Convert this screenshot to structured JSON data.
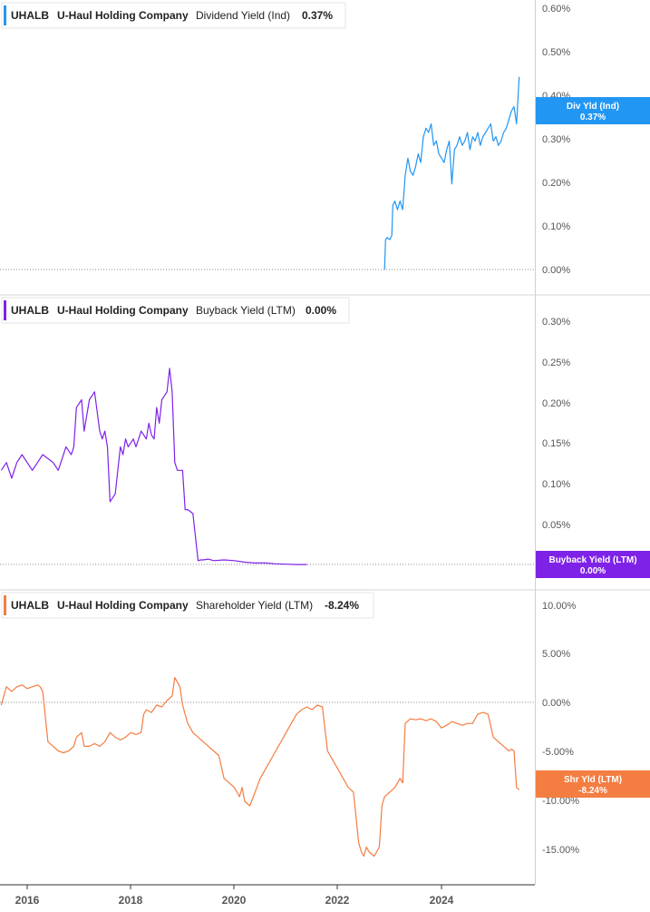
{
  "ticker": "UHALB",
  "company": "U-Haul Holding Company",
  "x_ticks": [
    "2016",
    "2018",
    "2020",
    "2022",
    "2024"
  ],
  "colors": {
    "dividend": "#2196f3",
    "buyback": "#7f22e8",
    "shareholder": "#f47d42"
  },
  "chart_data": [
    {
      "type": "line",
      "series": [
        {
          "name": "Dividend Yield (Ind)",
          "x": [
            2022.9,
            2022.92,
            2022.95,
            2023.0,
            2023.04,
            2023.06,
            2023.1,
            2023.15,
            2023.2,
            2023.25,
            2023.3,
            2023.35,
            2023.4,
            2023.45,
            2023.5,
            2023.55,
            2023.6,
            2023.65,
            2023.7,
            2023.75,
            2023.8,
            2023.85,
            2023.9,
            2023.95,
            2024.0,
            2024.05,
            2024.1,
            2024.15,
            2024.2,
            2024.25,
            2024.3,
            2024.35,
            2024.4,
            2024.45,
            2024.5,
            2024.55,
            2024.6,
            2024.65,
            2024.7,
            2024.75,
            2024.8,
            2024.85,
            2024.9,
            2024.95,
            2025.0,
            2025.05,
            2025.1,
            2025.15,
            2025.2,
            2025.25,
            2025.3,
            2025.35,
            2025.4,
            2025.45,
            2025.5
          ],
          "values": [
            0.0,
            0.07,
            0.075,
            0.07,
            0.08,
            0.15,
            0.16,
            0.14,
            0.16,
            0.14,
            0.22,
            0.26,
            0.23,
            0.22,
            0.24,
            0.27,
            0.25,
            0.31,
            0.33,
            0.32,
            0.34,
            0.29,
            0.3,
            0.27,
            0.26,
            0.25,
            0.28,
            0.3,
            0.2,
            0.28,
            0.29,
            0.31,
            0.29,
            0.3,
            0.32,
            0.28,
            0.31,
            0.3,
            0.32,
            0.29,
            0.31,
            0.32,
            0.33,
            0.34,
            0.3,
            0.31,
            0.29,
            0.3,
            0.32,
            0.33,
            0.35,
            0.37,
            0.38,
            0.34,
            0.45
          ]
        }
      ],
      "value_suffix": "%",
      "ylim": [
        -0.02,
        0.61
      ],
      "y_ticks": [
        "0.60%",
        "0.50%",
        "0.40%",
        "0.30%",
        "0.20%",
        "0.10%",
        "0.00%"
      ],
      "legend": {
        "label": "Dividend Yield (Ind)",
        "value": "0.37%"
      },
      "end_tag": {
        "label": "Div Yld (Ind)",
        "value": "0.37%"
      }
    },
    {
      "type": "line",
      "series": [
        {
          "name": "Buyback Yield (LTM)",
          "x": [
            2015.5,
            2015.6,
            2015.7,
            2015.8,
            2015.9,
            2016.0,
            2016.1,
            2016.2,
            2016.3,
            2016.4,
            2016.5,
            2016.6,
            2016.7,
            2016.75,
            2016.85,
            2016.9,
            2016.95,
            2017.05,
            2017.1,
            2017.2,
            2017.3,
            2017.4,
            2017.45,
            2017.5,
            2017.55,
            2017.6,
            2017.7,
            2017.8,
            2017.85,
            2017.9,
            2017.95,
            2018.0,
            2018.05,
            2018.1,
            2018.2,
            2018.3,
            2018.35,
            2018.4,
            2018.45,
            2018.5,
            2018.55,
            2018.6,
            2018.7,
            2018.75,
            2018.8,
            2018.85,
            2018.9,
            2019.0,
            2019.05,
            2019.1,
            2019.2,
            2019.3,
            2019.35,
            2019.4,
            2019.5,
            2019.6,
            2019.8,
            2020.0,
            2020.2,
            2020.3,
            2020.4,
            2020.6,
            2020.8,
            2021.0,
            2021.2,
            2021.4
          ],
          "values": [
            0.12,
            0.13,
            0.11,
            0.13,
            0.14,
            0.13,
            0.12,
            0.13,
            0.14,
            0.135,
            0.13,
            0.12,
            0.14,
            0.15,
            0.14,
            0.15,
            0.2,
            0.21,
            0.17,
            0.21,
            0.22,
            0.17,
            0.16,
            0.17,
            0.15,
            0.08,
            0.09,
            0.15,
            0.14,
            0.16,
            0.15,
            0.155,
            0.16,
            0.15,
            0.17,
            0.16,
            0.18,
            0.165,
            0.16,
            0.2,
            0.18,
            0.21,
            0.22,
            0.25,
            0.22,
            0.13,
            0.12,
            0.12,
            0.07,
            0.07,
            0.065,
            0.005,
            0.006,
            0.006,
            0.007,
            0.005,
            0.006,
            0.005,
            0.003,
            0.0025,
            0.002,
            0.002,
            0.001,
            0.0005,
            0.0,
            0.0
          ]
        }
      ],
      "value_suffix": "%",
      "ylim": [
        -0.005,
        0.31
      ],
      "y_ticks": [
        "0.30%",
        "0.25%",
        "0.20%",
        "0.15%",
        "0.10%",
        "0.05%"
      ],
      "legend": {
        "label": "Buyback Yield (LTM)",
        "value": "0.00%"
      },
      "end_tag": {
        "label": "Buyback Yield (LTM)",
        "value": "0.00%"
      }
    },
    {
      "type": "line",
      "series": [
        {
          "name": "Shareholder Yield (LTM)",
          "x": [
            2015.5,
            2015.6,
            2015.7,
            2015.8,
            2015.9,
            2016.0,
            2016.1,
            2016.2,
            2016.25,
            2016.3,
            2016.4,
            2016.5,
            2016.6,
            2016.7,
            2016.8,
            2016.9,
            2016.95,
            2017.05,
            2017.1,
            2017.2,
            2017.3,
            2017.4,
            2017.5,
            2017.6,
            2017.7,
            2017.8,
            2017.9,
            2018.0,
            2018.1,
            2018.2,
            2018.25,
            2018.3,
            2018.4,
            2018.5,
            2018.6,
            2018.7,
            2018.8,
            2018.85,
            2018.95,
            2019.0,
            2019.1,
            2019.2,
            2019.3,
            2019.4,
            2019.5,
            2019.6,
            2019.7,
            2019.8,
            2019.9,
            2020.0,
            2020.1,
            2020.15,
            2020.2,
            2020.3,
            2020.4,
            2020.5,
            2020.6,
            2020.7,
            2020.8,
            2020.9,
            2021.0,
            2021.1,
            2021.2,
            2021.3,
            2021.4,
            2021.5,
            2021.6,
            2021.7,
            2021.8,
            2021.9,
            2021.95,
            2022.0,
            2022.05,
            2022.1,
            2022.2,
            2022.3,
            2022.4,
            2022.45,
            2022.5,
            2022.55,
            2022.6,
            2022.7,
            2022.8,
            2022.85,
            2022.9,
            2023.0,
            2023.1,
            2023.2,
            2023.25,
            2023.3,
            2023.4,
            2023.5,
            2023.6,
            2023.7,
            2023.8,
            2023.9,
            2024.0,
            2024.1,
            2024.2,
            2024.3,
            2024.4,
            2024.5,
            2024.6,
            2024.7,
            2024.8,
            2024.9,
            2025.0,
            2025.1,
            2025.2,
            2025.3,
            2025.35,
            2025.4,
            2025.45,
            2025.5
          ],
          "values": [
            1.0,
            3.0,
            2.5,
            3.0,
            3.2,
            2.8,
            3.0,
            3.2,
            3.0,
            2.5,
            -3.0,
            -3.5,
            -4.0,
            -4.2,
            -4.0,
            -3.5,
            -2.5,
            -2.0,
            -3.5,
            -3.5,
            -3.2,
            -3.5,
            -3.0,
            -2.0,
            -2.5,
            -2.8,
            -2.5,
            -2.0,
            -2.2,
            -2.0,
            0.0,
            0.5,
            0.2,
            1.0,
            0.8,
            1.5,
            2.0,
            4.0,
            3.0,
            1.0,
            -1.0,
            -2.0,
            -2.5,
            -3.0,
            -3.5,
            -4.0,
            -4.5,
            -7.0,
            -7.5,
            -8.0,
            -9.0,
            -8.0,
            -9.5,
            -10.0,
            -8.5,
            -7.0,
            -6.0,
            -5.0,
            -4.0,
            -3.0,
            -2.0,
            -1.0,
            0.0,
            0.5,
            0.8,
            0.5,
            1.0,
            0.8,
            -4.0,
            -5.0,
            -5.5,
            -6.0,
            -6.5,
            -7.0,
            -8.0,
            -8.5,
            -14.0,
            -15.0,
            -15.5,
            -14.5,
            -15.0,
            -15.5,
            -14.5,
            -10.0,
            -9.0,
            -8.5,
            -8.0,
            -7.0,
            -7.5,
            -1.0,
            -0.5,
            -0.6,
            -0.5,
            -0.7,
            -0.5,
            -0.8,
            -1.5,
            -1.2,
            -0.8,
            -1.0,
            -1.2,
            -1.0,
            -1.0,
            0.0,
            0.2,
            0.0,
            -2.5,
            -3.0,
            -3.5,
            -4.0,
            -3.8,
            -4.0,
            -8.0,
            -8.24
          ]
        }
      ],
      "value_suffix": "%",
      "ylim": [
        -18.5,
        12.0
      ],
      "y_ticks": [
        "10.00%",
        "5.00%",
        "0.00%",
        "-5.00%",
        "-10.00%",
        "-15.00%"
      ],
      "legend": {
        "label": "Shareholder Yield (LTM)",
        "value": "-8.24%"
      },
      "end_tag": {
        "label": "Shr Yld (LTM)",
        "value": "-8.24%"
      }
    }
  ]
}
